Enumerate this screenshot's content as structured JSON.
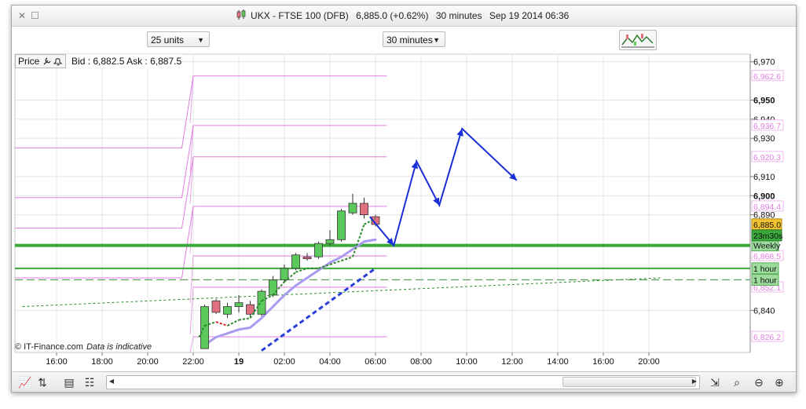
{
  "window": {
    "title_name": "UKX - FTSE 100 (DFB)",
    "title_price": "6,885.0 (+0.62%)",
    "title_interval": "30 minutes",
    "title_datetime": "Sep 19 2014 06:36",
    "close_glyph": "✕",
    "restore_glyph": "☐"
  },
  "toolbar": {
    "units_select": "25 units",
    "interval_select": "30 minutes"
  },
  "legend": {
    "price_label": "Price",
    "bid_ask": "Bid : 6,882.5 Ask : 6,887.5"
  },
  "footer": {
    "copyright": "© IT-Finance.com",
    "disclaimer": "Data is indicative"
  },
  "colors": {
    "up_candle": "#5cc95c",
    "down_candle": "#e0707f",
    "pivot_line": "#e27ee0",
    "support_green": "#3aa83a",
    "forecast_blue": "#1a2fd6",
    "ma_purple": "#a99bf0",
    "dashed_blue": "#2a3fd8",
    "dashed_green": "#2b8a2b",
    "price_marker": "#f2c230"
  },
  "chart_data": {
    "type": "candlestick",
    "y_axis": {
      "range": [
        6818,
        6974
      ],
      "ticks": [
        {
          "value": 6970,
          "label": "6,970",
          "bold": false
        },
        {
          "value": 6950,
          "label": "6,950",
          "bold": true
        },
        {
          "value": 6940,
          "label": "6,940",
          "bold": false
        },
        {
          "value": 6930,
          "label": "6,930",
          "bold": false
        },
        {
          "value": 6910,
          "label": "6,910",
          "bold": false
        },
        {
          "value": 6900,
          "label": "6,900",
          "bold": true
        },
        {
          "value": 6890,
          "label": "6,890",
          "bold": false
        },
        {
          "value": 6840,
          "label": "6,840",
          "bold": false
        }
      ]
    },
    "x_axis": {
      "labels": [
        {
          "pos": 0,
          "label": "16:00",
          "bold": false
        },
        {
          "pos": 4,
          "label": "18:00",
          "bold": false
        },
        {
          "pos": 8,
          "label": "20:00",
          "bold": false
        },
        {
          "pos": 12,
          "label": "22:00",
          "bold": false
        },
        {
          "pos": 16,
          "label": "19",
          "bold": true
        },
        {
          "pos": 20,
          "label": "02:00",
          "bold": false
        },
        {
          "pos": 24,
          "label": "04:00",
          "bold": false
        },
        {
          "pos": 28,
          "label": "06:00",
          "bold": false
        },
        {
          "pos": 32,
          "label": "08:00",
          "bold": false
        },
        {
          "pos": 36,
          "label": "10:00",
          "bold": false
        },
        {
          "pos": 40,
          "label": "12:00",
          "bold": false
        },
        {
          "pos": 44,
          "label": "14:00",
          "bold": false
        },
        {
          "pos": 48,
          "label": "16:00",
          "bold": false
        },
        {
          "pos": 52,
          "label": "20:00",
          "bold": false
        }
      ],
      "note": "pos = half-hour slots after 16:00 on Sep 18"
    },
    "candles": [
      {
        "pos": 13,
        "open": 6820,
        "high": 6843,
        "low": 6820,
        "close": 6842
      },
      {
        "pos": 14,
        "open": 6845,
        "high": 6846,
        "low": 6838,
        "close": 6839
      },
      {
        "pos": 15,
        "open": 6838,
        "high": 6844,
        "low": 6836,
        "close": 6842
      },
      {
        "pos": 16,
        "open": 6842,
        "high": 6848,
        "low": 6839,
        "close": 6844
      },
      {
        "pos": 17,
        "open": 6843,
        "high": 6845,
        "low": 6836,
        "close": 6838
      },
      {
        "pos": 18,
        "open": 6838,
        "high": 6851,
        "low": 6837,
        "close": 6850
      },
      {
        "pos": 19,
        "open": 6848,
        "high": 6858,
        "low": 6847,
        "close": 6856
      },
      {
        "pos": 20,
        "open": 6856,
        "high": 6864,
        "low": 6855,
        "close": 6862
      },
      {
        "pos": 21,
        "open": 6862,
        "high": 6870,
        "low": 6861,
        "close": 6869
      },
      {
        "pos": 22,
        "open": 6868,
        "high": 6870,
        "low": 6866,
        "close": 6867
      },
      {
        "pos": 23,
        "open": 6868,
        "high": 6876,
        "low": 6867,
        "close": 6875
      },
      {
        "pos": 24,
        "open": 6875,
        "high": 6882,
        "low": 6874,
        "close": 6877
      },
      {
        "pos": 25,
        "open": 6877,
        "high": 6893,
        "low": 6876,
        "close": 6892
      },
      {
        "pos": 26,
        "open": 6891,
        "high": 6901,
        "low": 6890,
        "close": 6896
      },
      {
        "pos": 27,
        "open": 6896,
        "high": 6899,
        "low": 6888,
        "close": 6890
      },
      {
        "pos": 28,
        "open": 6889,
        "high": 6890,
        "low": 6884,
        "close": 6885
      }
    ],
    "pivot_levels_right": [
      {
        "value": 6962.6,
        "label": "6,962.6"
      },
      {
        "value": 6936.7,
        "label": "6,936.7"
      },
      {
        "value": 6920.3,
        "label": "6,920.3"
      },
      {
        "value": 6894.4,
        "label": "6,894.4"
      },
      {
        "value": 6868.5,
        "label": "6,868.5"
      },
      {
        "value": 6852.1,
        "label": "6,852.1"
      },
      {
        "value": 6826.2,
        "label": "6,826.2"
      }
    ],
    "pivot_levels_left": [
      6925,
      6899,
      6883,
      6857
    ],
    "pivot_steps": {
      "left_end": 11,
      "step_at": 12,
      "right_start": 12.5,
      "right_end": 29
    },
    "current_price": {
      "value": 6885.0,
      "label": "6,885.0",
      "countdown": "23m30s"
    },
    "support_lines": [
      {
        "value": 6874,
        "label": "Weekly",
        "width": 4
      },
      {
        "value": 6862,
        "label": "1 hour",
        "width": 2
      }
    ],
    "horizontal_dashed": {
      "value": 6856,
      "label": "1 hour"
    },
    "trend_dashed_green": {
      "from": {
        "pos": -3,
        "value": 6842
      },
      "to": {
        "pos": 53,
        "value": 6857
      }
    },
    "moving_average": {
      "points": [
        {
          "pos": 13,
          "value": 6822
        },
        {
          "pos": 14,
          "value": 6826
        },
        {
          "pos": 15,
          "value": 6828
        },
        {
          "pos": 16,
          "value": 6830
        },
        {
          "pos": 17,
          "value": 6831
        },
        {
          "pos": 18,
          "value": 6836
        },
        {
          "pos": 19,
          "value": 6842
        },
        {
          "pos": 20,
          "value": 6848
        },
        {
          "pos": 21,
          "value": 6853
        },
        {
          "pos": 22,
          "value": 6857
        },
        {
          "pos": 23,
          "value": 6861
        },
        {
          "pos": 24,
          "value": 6865
        },
        {
          "pos": 25,
          "value": 6868
        },
        {
          "pos": 26,
          "value": 6872
        },
        {
          "pos": 27,
          "value": 6876
        },
        {
          "pos": 28,
          "value": 6877
        }
      ]
    },
    "signal_dashed": {
      "points": [
        {
          "pos": 12.5,
          "value": 6826
        },
        {
          "pos": 13,
          "value": 6832
        },
        {
          "pos": 14,
          "value": 6834
        },
        {
          "pos": 15,
          "value": 6832
        },
        {
          "pos": 16,
          "value": 6835
        },
        {
          "pos": 17,
          "value": 6836
        },
        {
          "pos": 18,
          "value": 6845
        },
        {
          "pos": 19,
          "value": 6848
        },
        {
          "pos": 20,
          "value": 6855
        },
        {
          "pos": 21,
          "value": 6860
        },
        {
          "pos": 22,
          "value": 6862
        },
        {
          "pos": 23,
          "value": 6862
        },
        {
          "pos": 24,
          "value": 6864
        },
        {
          "pos": 25,
          "value": 6866
        },
        {
          "pos": 26,
          "value": 6868
        },
        {
          "pos": 27,
          "value": 6885
        },
        {
          "pos": 28,
          "value": 6888
        }
      ]
    },
    "forecast_dashed_blue": {
      "from": {
        "pos": 18,
        "value": 6819
      },
      "to": {
        "pos": 28,
        "value": 6862
      }
    },
    "forecast_path": {
      "points": [
        {
          "pos": 27.5,
          "value": 6889
        },
        {
          "pos": 29.6,
          "value": 6874
        },
        {
          "pos": 31.6,
          "value": 6918
        },
        {
          "pos": 33.6,
          "value": 6895
        },
        {
          "pos": 35.6,
          "value": 6935
        },
        {
          "pos": 40.4,
          "value": 6908
        }
      ]
    }
  }
}
